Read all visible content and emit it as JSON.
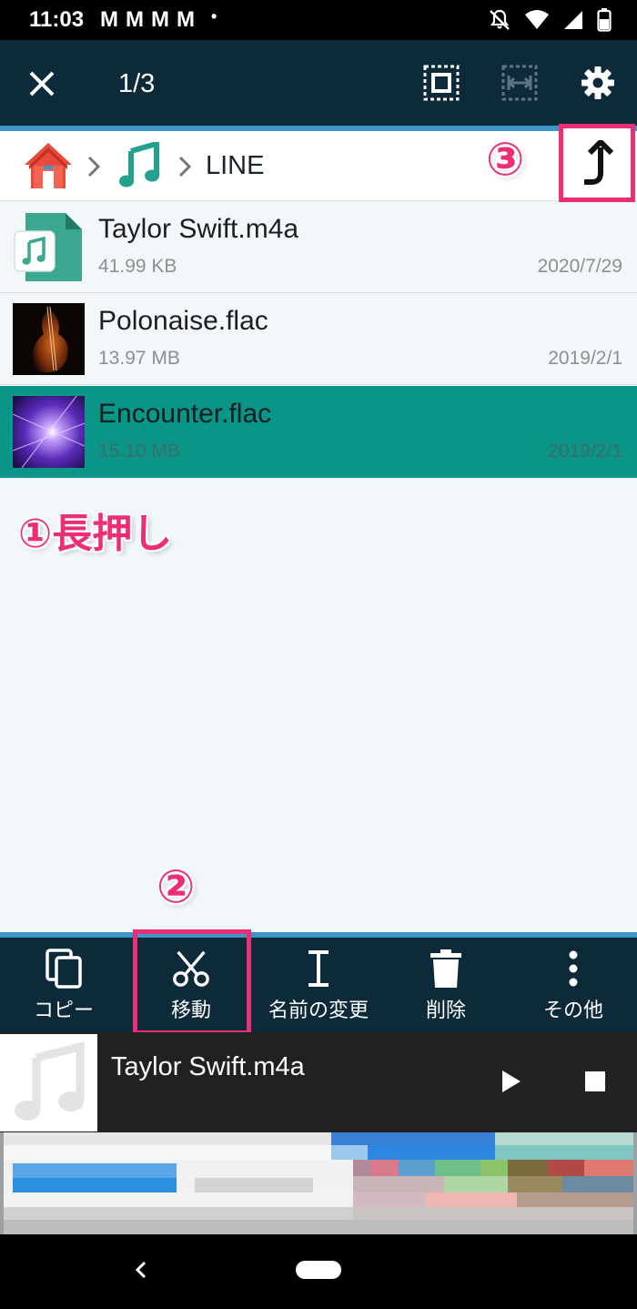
{
  "status_bar": {
    "time": "11:03",
    "notifications": [
      "M",
      "M",
      "M",
      "M",
      "•"
    ]
  },
  "app_bar": {
    "selection_count": "1/3"
  },
  "breadcrumb": {
    "folder": "LINE"
  },
  "files": [
    {
      "name": "Taylor Swift.m4a",
      "size": "41.99 KB",
      "date": "2020/7/29",
      "selected": false,
      "thumb": "music-file-icon"
    },
    {
      "name": "Polonaise.flac",
      "size": "13.97 MB",
      "date": "2019/2/1",
      "selected": false,
      "thumb": "violin-art"
    },
    {
      "name": "Encounter.flac",
      "size": "15.10 MB",
      "date": "2019/2/1",
      "selected": true,
      "thumb": "light-art"
    }
  ],
  "annotations": {
    "step1": "①長押し",
    "step2": "②",
    "step3": "③"
  },
  "actions": [
    {
      "label": "コピー",
      "icon": "copy-icon"
    },
    {
      "label": "移動",
      "icon": "scissors-icon"
    },
    {
      "label": "名前の変更",
      "icon": "text-cursor-icon"
    },
    {
      "label": "削除",
      "icon": "trash-icon"
    },
    {
      "label": "その他",
      "icon": "more-vert-icon"
    }
  ],
  "player": {
    "title": "Taylor Swift.m4a"
  },
  "colors": {
    "app_bar": "#0d2a3a",
    "accent_line": "#3d95c8",
    "selected_row": "#0a9587",
    "annotation": "#ec2f74",
    "music_teal": "#23a08e"
  }
}
